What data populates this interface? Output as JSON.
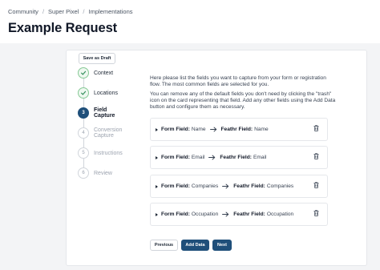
{
  "breadcrumb": [
    "Community",
    "Super Pixel",
    "Implementations"
  ],
  "breadcrumb_separator": "/",
  "page_title": "Example Request",
  "draft_button": "Save as Draft",
  "steps": [
    {
      "number": "1",
      "label": "Context",
      "state": "done"
    },
    {
      "number": "2",
      "label": "Locations",
      "state": "done"
    },
    {
      "number": "3",
      "label": "Field Capture",
      "state": "active"
    },
    {
      "number": "4",
      "label": "Conversion Capture",
      "state": "pending"
    },
    {
      "number": "5",
      "label": "Instructions",
      "state": "pending"
    },
    {
      "number": "6",
      "label": "Review",
      "state": "pending"
    }
  ],
  "intro": [
    "Here please list the fields you want to capture from your form or registration flow. The most common fields are selected for you.",
    "You can remove any of the default fields you don't need by clicking the \"trash\" icon on the card representing that field. Add any other fields using the Add Data button and configure them as necessary."
  ],
  "form_field_label": "Form Field:",
  "feathr_field_label": "Feathr Field:",
  "fields": [
    {
      "form": "Name",
      "feathr": "Name"
    },
    {
      "form": "Email",
      "feathr": "Email"
    },
    {
      "form": "Companies",
      "feathr": "Companies"
    },
    {
      "form": "Occupation",
      "feathr": "Occupation"
    }
  ],
  "buttons": {
    "previous": "Previous",
    "add_data": "Add Data",
    "next": "Next"
  },
  "colors": {
    "primary": "#1f4f7a",
    "done_circle_border": "#86c995",
    "done_check": "#2e8b57",
    "background": "#f3f4f6"
  },
  "icons": {
    "done_step": "check-icon",
    "field_row": "caret-right-icon",
    "mapping": "arrow-right-icon",
    "remove": "trash-icon"
  }
}
